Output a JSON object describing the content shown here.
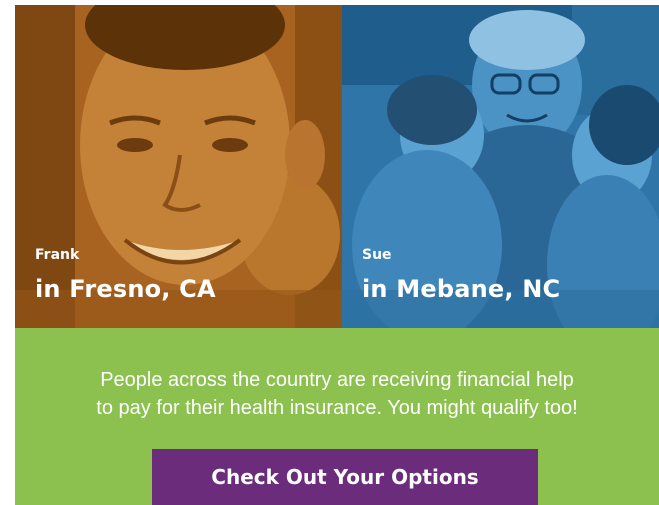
{
  "colors": {
    "frank_tint": "#b26a22",
    "sue_tint": "#2e77ad",
    "panel_green": "#8cc04f",
    "button_purple": "#6b2c7b",
    "text_white": "#ffffff"
  },
  "profiles": [
    {
      "name": "Frank",
      "location": "in Fresno, CA"
    },
    {
      "name": "Sue",
      "location": "in Mebane, NC"
    }
  ],
  "message": {
    "line1": "People across the country are receiving financial help",
    "line2": "to pay for their health insurance. You might qualify too!"
  },
  "cta": {
    "label": "Check Out Your Options"
  }
}
